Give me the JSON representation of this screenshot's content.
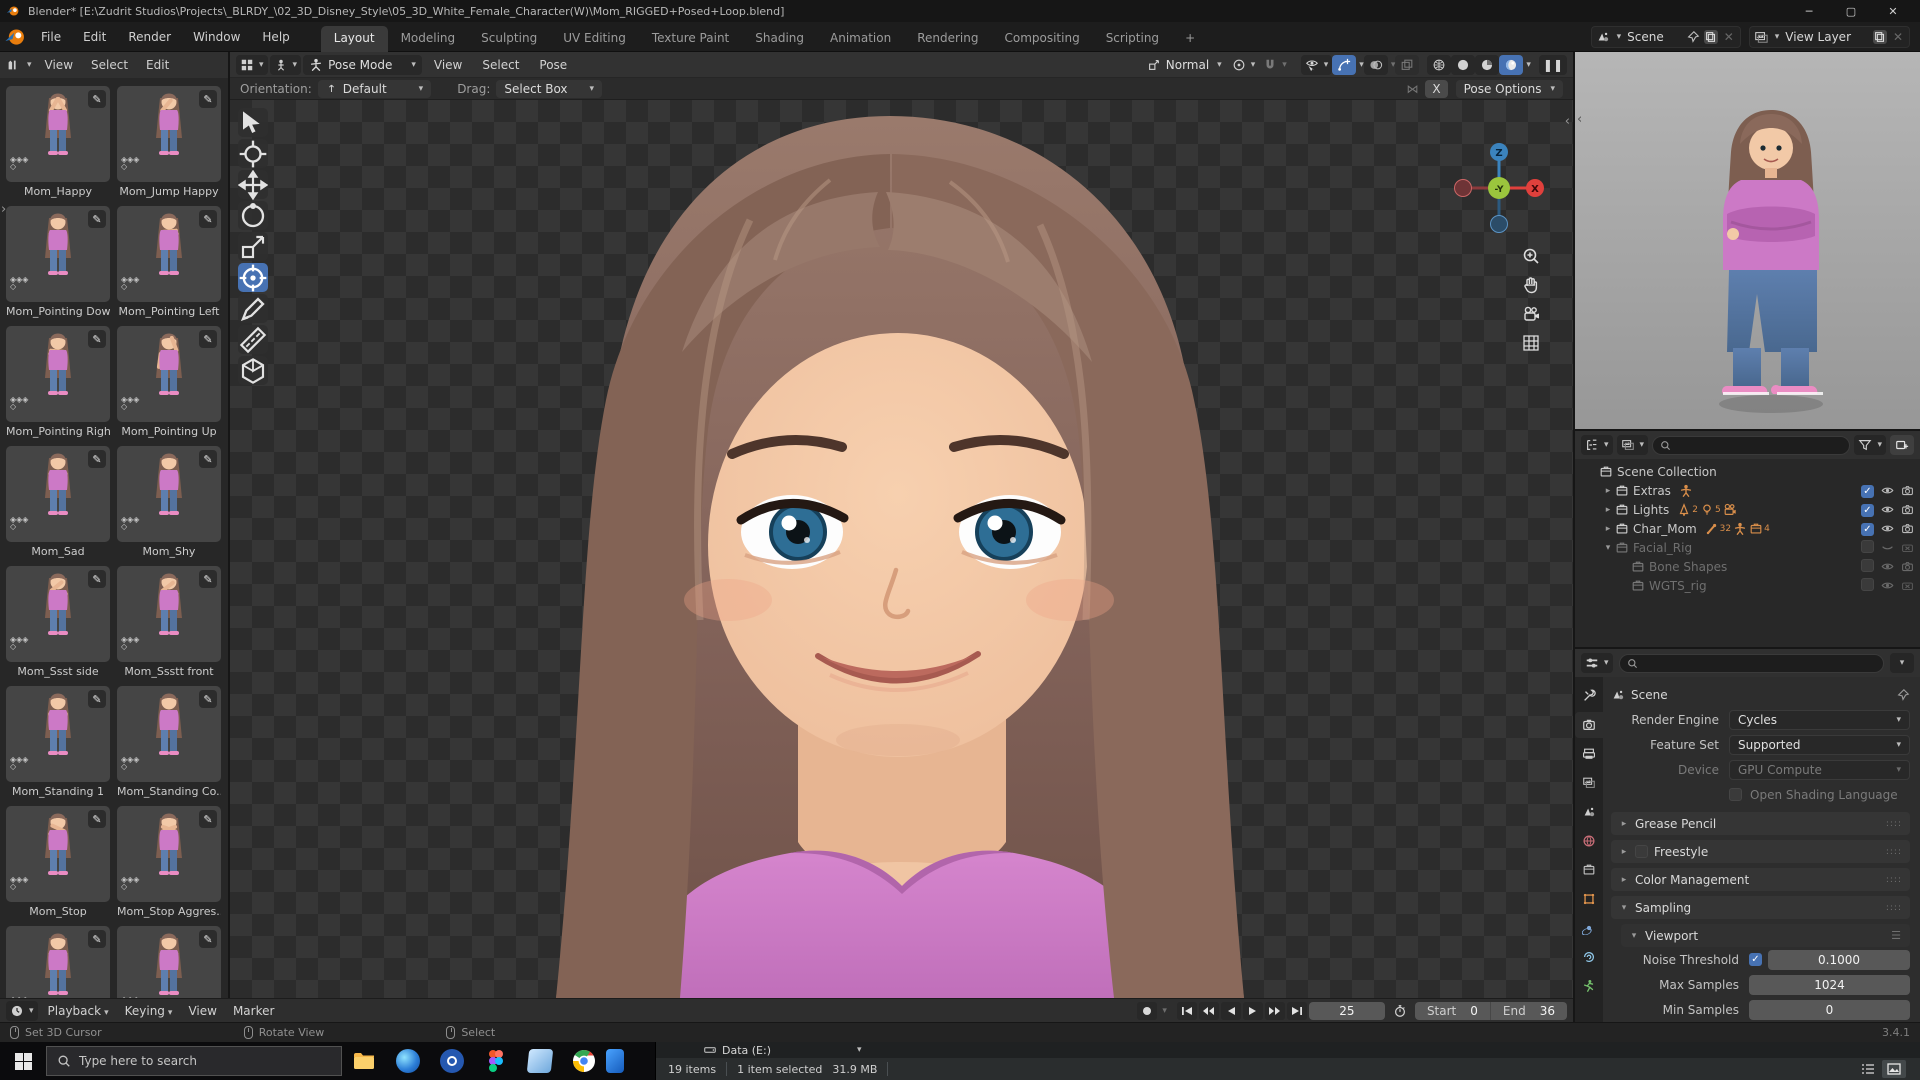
{
  "window": {
    "title": "Blender* [E:\\Zudrit Studios\\Projects\\_BLRDY_\\02_3D_Disney_Style\\05_3D_White_Female_Character(W)\\Mom_RIGGED+Posed+Loop.blend]",
    "controls": {
      "minimize": "─",
      "maximize": "▢",
      "close": "✕"
    }
  },
  "topbar": {
    "menus": [
      "File",
      "Edit",
      "Render",
      "Window",
      "Help"
    ],
    "tabs": [
      "Layout",
      "Modeling",
      "Sculpting",
      "UV Editing",
      "Texture Paint",
      "Shading",
      "Animation",
      "Rendering",
      "Compositing",
      "Scripting"
    ],
    "active_tab": "Layout",
    "new_tab": "+",
    "scene_selector": "Scene",
    "view_layer_selector": "View Layer"
  },
  "asset_browser": {
    "menus": [
      "View",
      "Select",
      "Edit"
    ],
    "poses": [
      "Mom_Happy",
      "Mom_Jump Happy",
      "Mom_Pointing Down",
      "Mom_Pointing Left",
      "Mom_Pointing Right",
      "Mom_Pointing Up",
      "Mom_Sad",
      "Mom_Shy",
      "Mom_Ssst side",
      "Mom_Ssstt front",
      "Mom_Standing 1",
      "Mom_Standing Co...",
      "Mom_Stop",
      "Mom_Stop Aggres...",
      "",
      ""
    ]
  },
  "viewport": {
    "mode": "Pose Mode",
    "menus": [
      "View",
      "Select",
      "Pose"
    ],
    "pivot": "Normal",
    "tool_settings": {
      "orientation_label": "Orientation:",
      "orientation_value": "Default",
      "drag_label": "Drag:",
      "drag_value": "Select Box",
      "mirror_x": "X",
      "pose_options": "Pose Options"
    },
    "gizmo_axes": {
      "x": "X",
      "y": "-Y",
      "z": "Z"
    }
  },
  "outliner": {
    "rows": [
      {
        "label": "Scene Collection",
        "level": 0,
        "icon": "collection",
        "caret": "",
        "disabled": false,
        "badges": [],
        "toggles": []
      },
      {
        "label": "Extras",
        "level": 1,
        "icon": "collection",
        "caret": "right",
        "disabled": false,
        "badges": [
          {
            "icon": "armature",
            "count": ""
          }
        ],
        "toggles": [
          "check-on",
          "eye",
          "camera"
        ]
      },
      {
        "label": "Lights",
        "level": 1,
        "icon": "collection",
        "caret": "right",
        "disabled": false,
        "badges": [
          {
            "icon": "probe",
            "count": "2"
          },
          {
            "icon": "light",
            "count": "5"
          },
          {
            "icon": "movie-camera",
            "count": ""
          }
        ],
        "toggles": [
          "check-on",
          "eye",
          "camera"
        ]
      },
      {
        "label": "Char_Mom",
        "level": 1,
        "icon": "collection",
        "caret": "right",
        "disabled": false,
        "badges": [
          {
            "icon": "bone",
            "count": "32"
          },
          {
            "icon": "armature",
            "count": ""
          },
          {
            "icon": "collection",
            "count": "4"
          }
        ],
        "toggles": [
          "check-on",
          "eye",
          "camera"
        ]
      },
      {
        "label": "Facial_Rig",
        "level": 1,
        "icon": "collection",
        "caret": "down",
        "disabled": true,
        "badges": [],
        "toggles": [
          "check-off",
          "eye-closed",
          "camera-off"
        ]
      },
      {
        "label": "Bone Shapes",
        "level": 2,
        "icon": "collection",
        "caret": "",
        "disabled": true,
        "badges": [],
        "toggles": [
          "check-off",
          "eye",
          "camera"
        ]
      },
      {
        "label": "WGTS_rig",
        "level": 2,
        "icon": "collection",
        "caret": "",
        "disabled": true,
        "badges": [],
        "toggles": [
          "check-off",
          "eye",
          "camera-off"
        ]
      }
    ]
  },
  "properties": {
    "nav_label": "Scene",
    "tabs": [
      "tool",
      "render",
      "output",
      "view-layer",
      "scene",
      "world",
      "collection",
      "object",
      "constraints",
      "physics",
      "data"
    ],
    "active_tab": "render",
    "fields": [
      {
        "label": "Render Engine",
        "value": "Cycles",
        "type": "dropdown",
        "disabled": false
      },
      {
        "label": "Feature Set",
        "value": "Supported",
        "type": "dropdown",
        "disabled": false
      },
      {
        "label": "Device",
        "value": "GPU Compute",
        "type": "dropdown",
        "disabled": true
      },
      {
        "label": "Open Shading Language",
        "value": "",
        "type": "checkbox",
        "checked": false,
        "disabled": true
      }
    ],
    "panels": [
      {
        "label": "Grease Pencil",
        "expanded": false,
        "checkbox": false
      },
      {
        "label": "Freestyle",
        "expanded": false,
        "checkbox": true
      },
      {
        "label": "Color Management",
        "expanded": false,
        "checkbox": false
      },
      {
        "label": "Sampling",
        "expanded": true,
        "checkbox": false
      }
    ],
    "sampling": {
      "subpanel": "Viewport",
      "rows": [
        {
          "label": "Noise Threshold",
          "checkbox": true,
          "value": "0.1000"
        },
        {
          "label": "Max Samples",
          "checkbox": false,
          "value": "1024"
        },
        {
          "label": "Min Samples",
          "checkbox": false,
          "value": "0"
        }
      ]
    }
  },
  "timeline": {
    "menus": [
      {
        "label": "Playback",
        "caret": true
      },
      {
        "label": "Keying",
        "caret": true
      },
      {
        "label": "View",
        "caret": false
      },
      {
        "label": "Marker",
        "caret": false
      }
    ],
    "current_frame": "25",
    "start_label": "Start",
    "start_value": "0",
    "end_label": "End",
    "end_value": "36"
  },
  "statusbar": {
    "hints": [
      "Set 3D Cursor",
      "Rotate View",
      "Select"
    ],
    "version": "3.4.1"
  },
  "taskbar": {
    "search_placeholder": "Type here to search",
    "apps": [
      "file-explorer",
      "edge",
      "media-player",
      "figma",
      "3d-viewer",
      "chrome",
      "hidden-app"
    ]
  },
  "explorer": {
    "title": "Data (E:)",
    "items_count": "19 items",
    "selection": "1 item selected",
    "size": "31.9 MB"
  },
  "colors": {
    "accent_blue": "#4772b3",
    "axis_x": "#e0403c",
    "axis_y": "#9bc53d",
    "axis_z": "#3b83bd",
    "icon_orange": "#d98e4a",
    "shirt_pink": "#cc79c6"
  }
}
